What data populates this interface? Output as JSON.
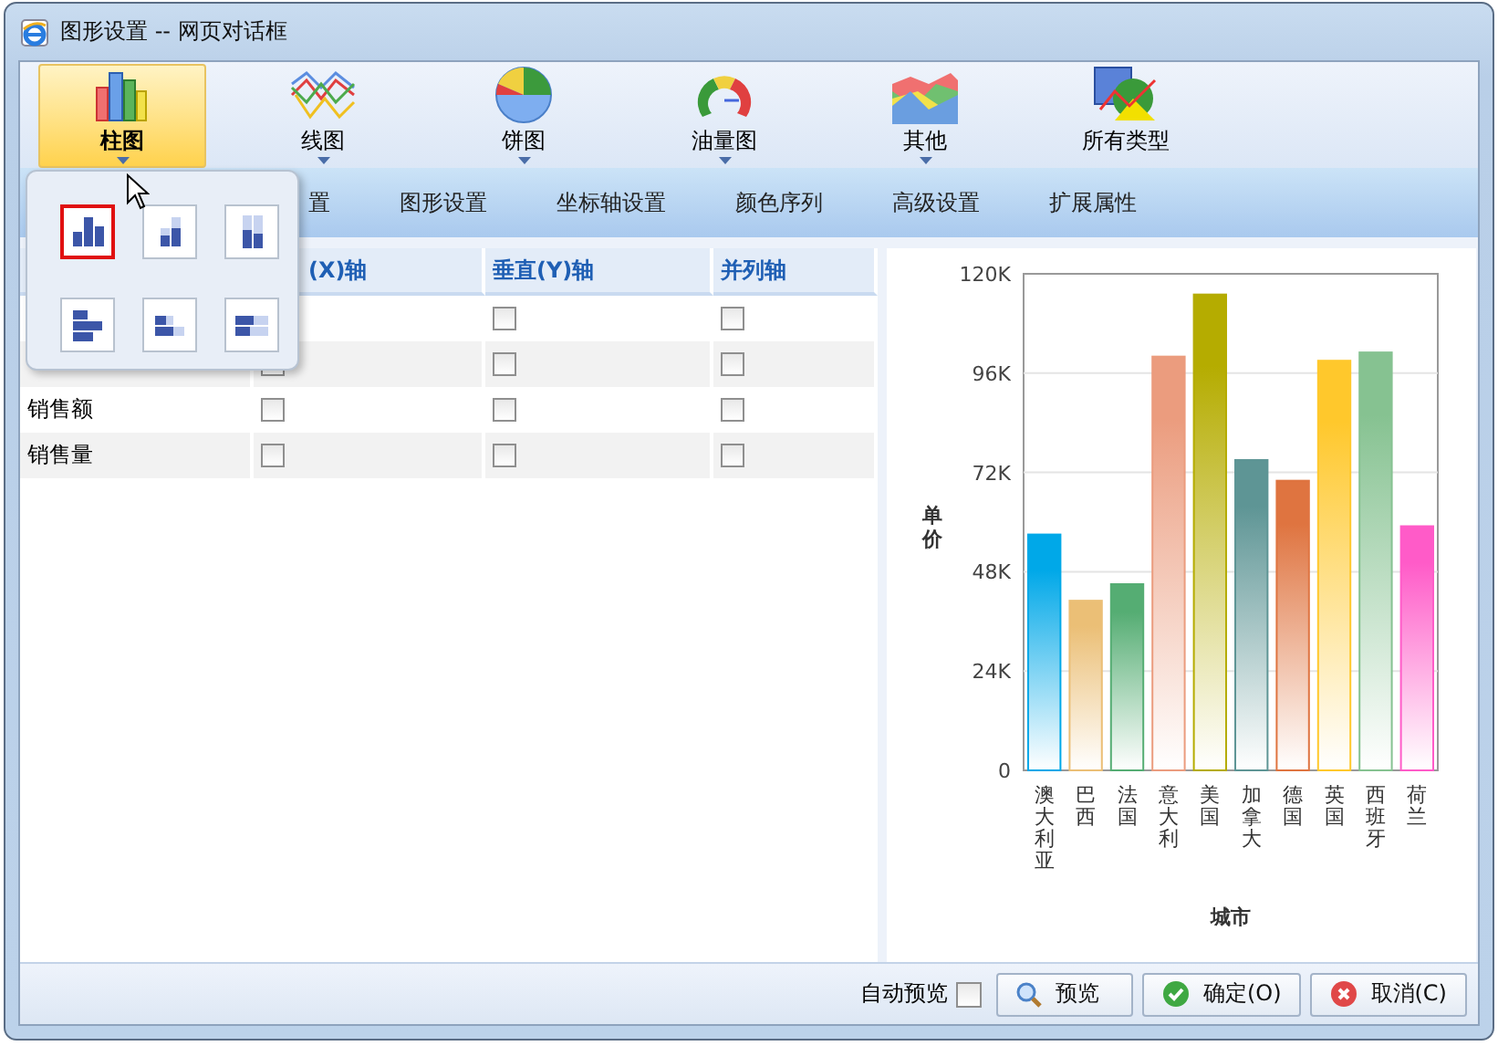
{
  "window": {
    "title": "图形设置 -- 网页对话框"
  },
  "ribbon": [
    {
      "label": "柱图",
      "kind": "bar",
      "selected": true,
      "has_menu": true
    },
    {
      "label": "线图",
      "kind": "line",
      "selected": false,
      "has_menu": true
    },
    {
      "label": "饼图",
      "kind": "pie",
      "selected": false,
      "has_menu": true
    },
    {
      "label": "油量图",
      "kind": "gauge",
      "selected": false,
      "has_menu": true
    },
    {
      "label": "其他",
      "kind": "area",
      "selected": false,
      "has_menu": true
    },
    {
      "label": "所有类型",
      "kind": "all",
      "selected": false,
      "has_menu": false
    }
  ],
  "subtype_menu": [
    {
      "kind": "clustered-column",
      "selected": true
    },
    {
      "kind": "stacked-column",
      "selected": false
    },
    {
      "kind": "full-column",
      "selected": false
    },
    {
      "kind": "clustered-bar",
      "selected": false
    },
    {
      "kind": "stacked-bar",
      "selected": false
    },
    {
      "kind": "full-bar",
      "selected": false
    }
  ],
  "tabs": [
    {
      "label": "置"
    },
    {
      "label": "图形设置"
    },
    {
      "label": "坐标轴设置"
    },
    {
      "label": "颜色序列"
    },
    {
      "label": "高级设置"
    },
    {
      "label": "扩展属性"
    }
  ],
  "table": {
    "columns": [
      "(X)轴",
      "垂直(Y)轴",
      "并列轴"
    ],
    "rows": [
      {
        "y": false,
        "parallel": false
      },
      {
        "x": false,
        "y": false,
        "parallel": false
      },
      {
        "label": "销售额",
        "x": false,
        "y": false,
        "parallel": false
      },
      {
        "label": "销售量",
        "x": false,
        "y": false,
        "parallel": false
      }
    ]
  },
  "chart": {
    "chart_data": {
      "type": "bar",
      "xlabel": "城市",
      "ylabel": "单价",
      "grid": true,
      "categories": [
        "澳大利亚",
        "巴西",
        "法国",
        "意大利",
        "美国",
        "加拿大",
        "德国",
        "英国",
        "西班牙",
        "荷兰"
      ],
      "values": [
        57000,
        41000,
        45000,
        100000,
        115000,
        75000,
        70000,
        99000,
        101000,
        59000
      ],
      "colors": [
        "#00a8e8",
        "#ebbf76",
        "#55ad73",
        "#eb9c7e",
        "#b5ac00",
        "#5e9595",
        "#df7440",
        "#ffc82c",
        "#86c291",
        "#ff5bc8"
      ],
      "ylim": [
        0,
        120000
      ],
      "yticks": [
        {
          "value": 0,
          "label": "0"
        },
        {
          "value": 24000,
          "label": "24K"
        },
        {
          "value": 48000,
          "label": "48K"
        },
        {
          "value": 72000,
          "label": "72K"
        },
        {
          "value": 96000,
          "label": "96K"
        },
        {
          "value": 120000,
          "label": "120K"
        }
      ]
    }
  },
  "footer": {
    "auto_preview": {
      "label": "自动预览",
      "checked": false
    },
    "buttons": [
      {
        "label": "预览",
        "kind": "preview"
      },
      {
        "label": "确定(O)",
        "kind": "ok"
      },
      {
        "label": "取消(C)",
        "kind": "cancel"
      }
    ]
  }
}
